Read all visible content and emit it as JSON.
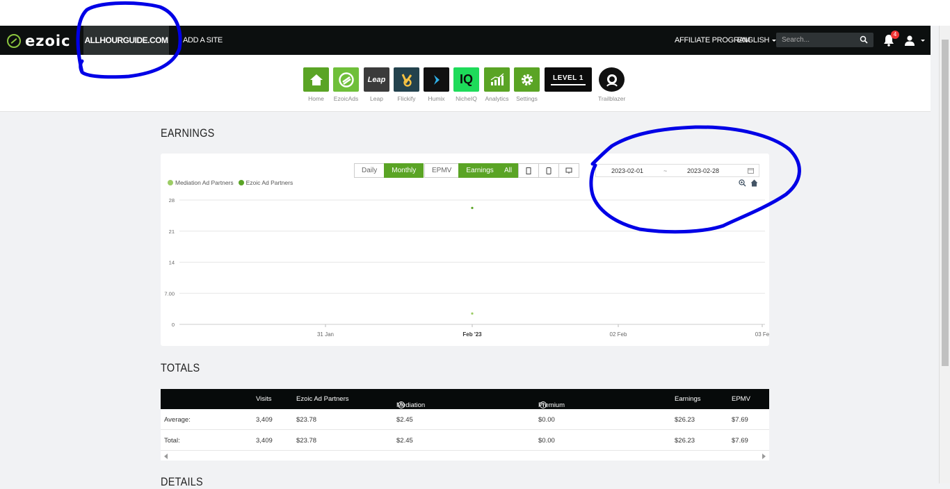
{
  "nav": {
    "logo": "ezoic",
    "site": "ALLHOURGUIDE.COM",
    "add_site": "ADD A SITE",
    "affiliate": "AFFILIATE PROGRAM",
    "language": "ENGLISH",
    "search_placeholder": "Search...",
    "notification_count": "4"
  },
  "apps": [
    {
      "label": "Home",
      "icon": "home-icon",
      "color": "#5aa425"
    },
    {
      "label": "EzoicAds",
      "icon": "ezoic-icon",
      "color": "#6fbf3a"
    },
    {
      "label": "Leap",
      "icon": "leap-icon",
      "color": "#3b3b3b"
    },
    {
      "label": "Flickify",
      "icon": "flickify-icon",
      "color": "#23424d"
    },
    {
      "label": "Humix",
      "icon": "humix-icon",
      "color": "#111111"
    },
    {
      "label": "NicheIQ",
      "icon": "nicheiq-icon",
      "color": "#1edb5a"
    },
    {
      "label": "Analytics",
      "icon": "analytics-icon",
      "color": "#5aa425"
    },
    {
      "label": "Settings",
      "icon": "gear-icon",
      "color": "#5aa425"
    },
    {
      "label": "",
      "icon": "level-icon",
      "color": "#0b0b0b"
    },
    {
      "label": "Trailblazer",
      "icon": "trailblazer-icon",
      "color": "#111111"
    }
  ],
  "level_text": "LEVEL 1",
  "leap_text": "Leap",
  "iq_text": "IQ",
  "earnings": {
    "title": "EARNINGS",
    "period_buttons": [
      "Daily",
      "Monthly"
    ],
    "metric_buttons": [
      "EPMV",
      "Earnings"
    ],
    "device_buttons": [
      "All"
    ],
    "date_start": "2023-02-01",
    "date_sep": "~",
    "date_end": "2023-02-28",
    "legend": [
      "Mediation Ad Partners",
      "Ezoic Ad Partners"
    ]
  },
  "chart_data": {
    "type": "scatter",
    "x_ticks": [
      "31 Jan",
      "Feb '23",
      "02 Feb",
      "03 Fe"
    ],
    "y_ticks": [
      "0",
      "7.00",
      "14",
      "21",
      "28"
    ],
    "ylim": [
      0,
      28
    ],
    "series": [
      {
        "name": "Mediation Ad Partners",
        "color": "#9ccc65",
        "points": [
          {
            "x": "Feb '23",
            "y": 2.45
          }
        ]
      },
      {
        "name": "Ezoic Ad Partners",
        "color": "#5aa425",
        "points": [
          {
            "x": "Feb '23",
            "y": 26.23
          }
        ]
      }
    ]
  },
  "totals": {
    "title": "TOTALS",
    "headers": [
      "",
      "Visits",
      "Ezoic Ad Partners",
      "Mediation Ad Partners",
      "Premium Ad Partners",
      "Earnings",
      "EPMV"
    ],
    "rows": [
      [
        "Average:",
        "3,409",
        "$23.78",
        "$2.45",
        "$0.00",
        "$26.23",
        "$7.69"
      ],
      [
        "Total:",
        "3,409",
        "$23.78",
        "$2.45",
        "$0.00",
        "$26.23",
        "$7.69"
      ]
    ]
  },
  "details_title": "DETAILS",
  "annotation_color": "#0000e6"
}
